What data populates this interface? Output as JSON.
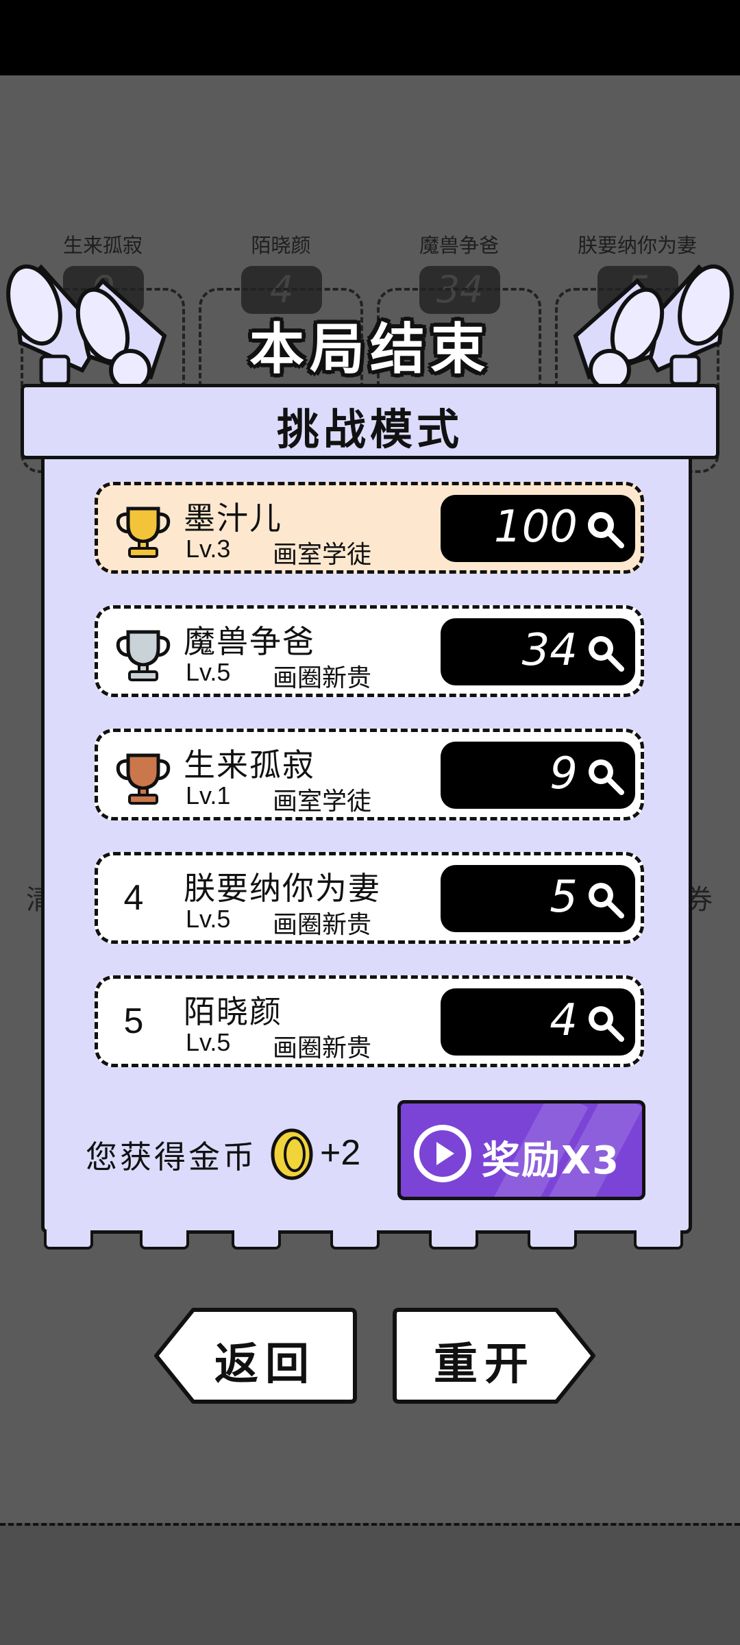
{
  "background_players": [
    {
      "name": "生来孤寂",
      "score": "9"
    },
    {
      "name": "陌晓颜",
      "score": "4"
    },
    {
      "name": "魔兽争爸",
      "score": "34"
    },
    {
      "name": "朕要纳你为妻",
      "score": "5"
    }
  ],
  "background_side_left": "清",
  "background_side_right": "券",
  "result_title": "本局结束",
  "mode_title": "挑战模式",
  "leaderboard": [
    {
      "rank_icon": "gold-trophy-icon",
      "rank": "",
      "name": "墨汁儿",
      "level": "Lv.3",
      "title": "画室学徒",
      "score": "100"
    },
    {
      "rank_icon": "silver-trophy-icon",
      "rank": "",
      "name": "魔兽争爸",
      "level": "Lv.5",
      "title": "画圈新贵",
      "score": "34"
    },
    {
      "rank_icon": "bronze-trophy-icon",
      "rank": "",
      "name": "生来孤寂",
      "level": "Lv.1",
      "title": "画室学徒",
      "score": "9"
    },
    {
      "rank_icon": "",
      "rank": "4",
      "name": "朕要纳你为妻",
      "level": "Lv.5",
      "title": "画圈新贵",
      "score": "5"
    },
    {
      "rank_icon": "",
      "rank": "5",
      "name": "陌晓颜",
      "level": "Lv.5",
      "title": "画圈新贵",
      "score": "4"
    }
  ],
  "coins": {
    "label": "您获得金币",
    "amount": "+2"
  },
  "reward_button": {
    "label": "奖励X3"
  },
  "buttons": {
    "back": "返回",
    "restart": "重开"
  },
  "colors": {
    "panel": "#dcdbfb",
    "highlight_row": "#fde8cf",
    "reward": "#7b44d6",
    "gold": "#f3c43a",
    "silver": "#c9d2d6",
    "bronze": "#c9774b"
  }
}
